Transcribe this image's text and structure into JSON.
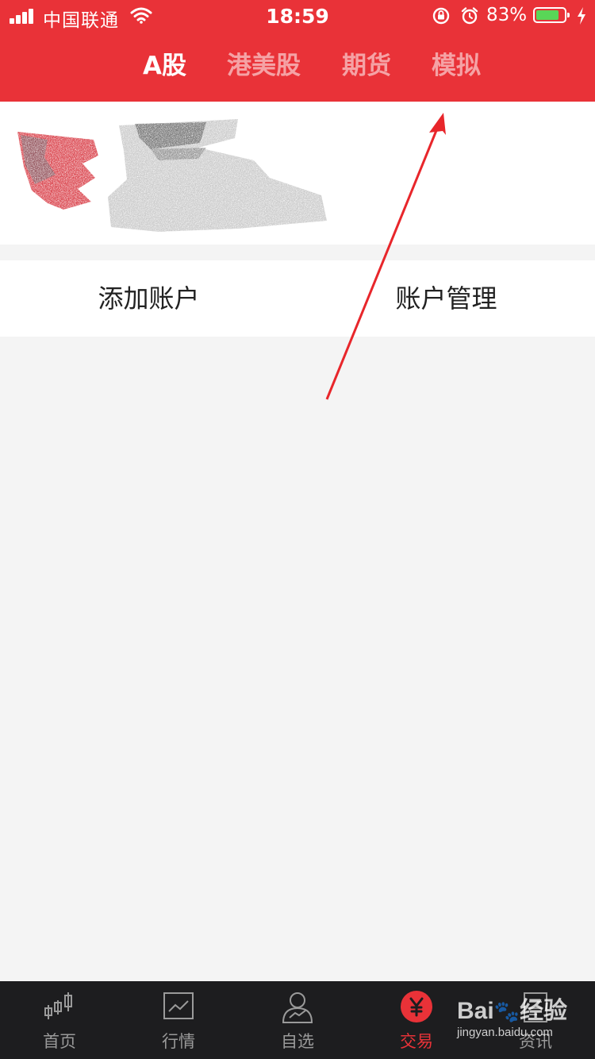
{
  "status_bar": {
    "carrier": "中国联通",
    "time": "18:59",
    "battery_percent": "83%",
    "battery_level": 0.83,
    "battery_color": "#59d657"
  },
  "header": {
    "background": "#e93238",
    "tabs": [
      {
        "label": "A股",
        "active": true
      },
      {
        "label": "港美股",
        "active": false
      },
      {
        "label": "期货",
        "active": false
      },
      {
        "label": "模拟",
        "active": false
      }
    ]
  },
  "actions": {
    "add_account": "添加账户",
    "manage_account": "账户管理"
  },
  "tabbar": {
    "items": [
      {
        "label": "首页",
        "icon": "candlestick-icon",
        "active": false
      },
      {
        "label": "行情",
        "icon": "line-chart-icon",
        "active": false
      },
      {
        "label": "自选",
        "icon": "person-chart-icon",
        "active": false
      },
      {
        "label": "交易",
        "icon": "yen-icon",
        "active": true
      },
      {
        "label": "资讯",
        "icon": "document-icon",
        "active": false
      }
    ],
    "active_color": "#e93238"
  },
  "watermark": {
    "text": "jingyan.baidu.com"
  }
}
